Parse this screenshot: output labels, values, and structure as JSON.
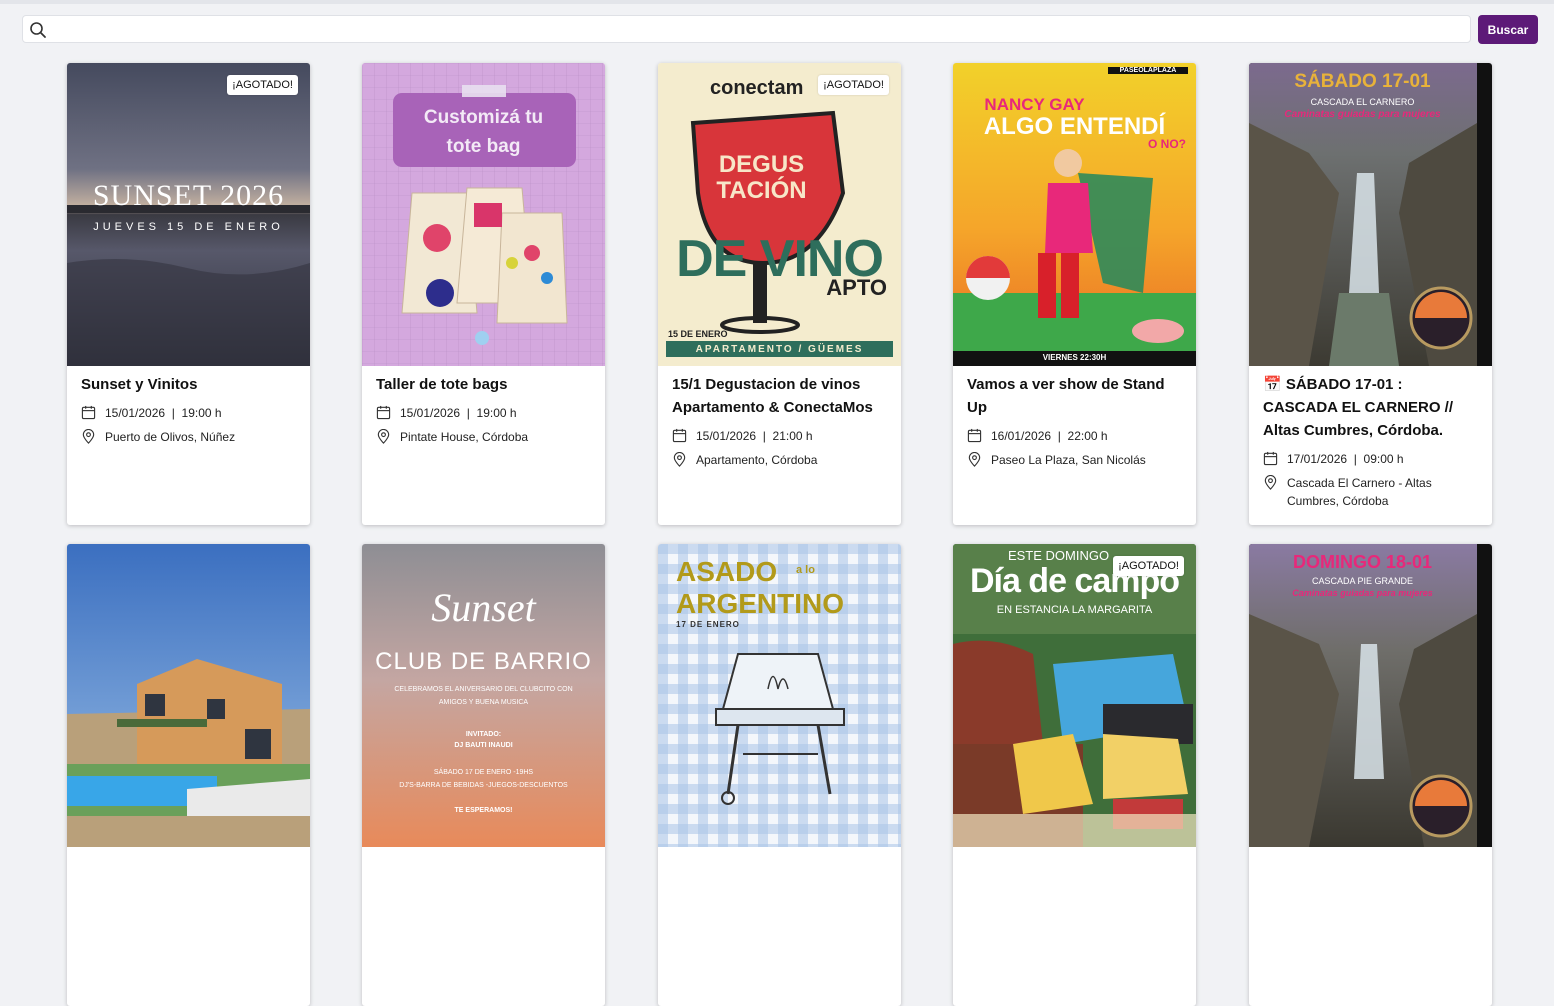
{
  "search": {
    "placeholder": "",
    "button_label": "Buscar"
  },
  "colors": {
    "accent": "#5d1a78",
    "background": "#f1f2f5"
  },
  "icons": {
    "search": "search-icon",
    "date": "calendar-icon",
    "location": "location-pin-icon"
  },
  "events": [
    {
      "title": "Sunset y Vinitos",
      "date": "15/01/2026",
      "time": "19:00 h",
      "location": "Puerto de Olivos, Núñez",
      "badge": "¡AGOTADO!",
      "poster": {
        "line1": "SUNSET 2026",
        "line2": "JUEVES 15 DE ENERO"
      }
    },
    {
      "title": "Taller de tote bags",
      "date": "15/01/2026",
      "time": "19:00 h",
      "location": "Pintate House, Córdoba",
      "badge": "",
      "poster": {
        "line1": "Customizá tu",
        "line2": "tote bag"
      }
    },
    {
      "title": "15/1 Degustacion de vinos Apartamento & ConectaMos",
      "date": "15/01/2026",
      "time": "21:00 h",
      "location": "Apartamento, Córdoba",
      "badge": "¡AGOTADO!",
      "poster": {
        "brand": "conectam",
        "line1": "DEGUS",
        "line2": "TACIÓN",
        "line3": "DE VINO",
        "line4": "APTO",
        "footer1": "15 DE ENERO",
        "footer2": "APARTAMENTO / GÜEMES"
      }
    },
    {
      "title": "Vamos a ver show de Stand Up",
      "date": "16/01/2026",
      "time": "22:00 h",
      "location": "Paseo La Plaza, San Nicolás",
      "badge": "",
      "poster": {
        "brand": "PASEOLAPLAZA",
        "line1": "NANCY GAY",
        "line2": "ALGO ENTENDÍ",
        "line3": "O NO?",
        "footer": "VIERNES 22:30H"
      }
    },
    {
      "title": "📅 SÁBADO 17-01 : CASCADA EL CARNERO // Altas Cumbres, Córdoba.",
      "date": "17/01/2026",
      "time": "09:00 h",
      "location": "Cascada El Carnero - Altas Cumbres, Córdoba",
      "badge": "",
      "poster": {
        "line1": "SÁBADO 17-01",
        "line2": "CASCADA EL CARNERO",
        "line3": "Caminatas guiadas para mujeres"
      }
    },
    {
      "title": "",
      "badge": "",
      "poster": {}
    },
    {
      "title": "",
      "badge": "",
      "poster": {
        "line1": "Sunset",
        "line2": "CLUB DE BARRIO",
        "line3": "CELEBRAMOS EL ANIVERSARIO DEL CLUBCITO CON",
        "line4": "AMIGOS Y BUENA MUSICA",
        "line5": "INVITADO:",
        "line6": "DJ BAUTI INAUDI",
        "line7": "SÁBADO 17 DE ENERO -19HS",
        "line8": "DJ'S-BARRA DE BEBIDAS -JUEGOS-DESCUENTOS",
        "line9": "TE ESPERAMOS!"
      }
    },
    {
      "title": "",
      "badge": "",
      "poster": {
        "line1": "ASADO",
        "line1b": "a lo",
        "line2": "ARGENTINO",
        "line3": "17 DE ENERO"
      }
    },
    {
      "title": "",
      "badge": "¡AGOTADO!",
      "poster": {
        "line1": "ESTE DOMINGO",
        "line2": "Día de campo",
        "line3": "EN ESTANCIA LA MARGARITA"
      }
    },
    {
      "title": "",
      "badge": "",
      "poster": {
        "line1": "DOMINGO 18-01",
        "line2": "CASCADA PIE GRANDE",
        "line3": "Caminatas guiadas para mujeres"
      }
    }
  ]
}
